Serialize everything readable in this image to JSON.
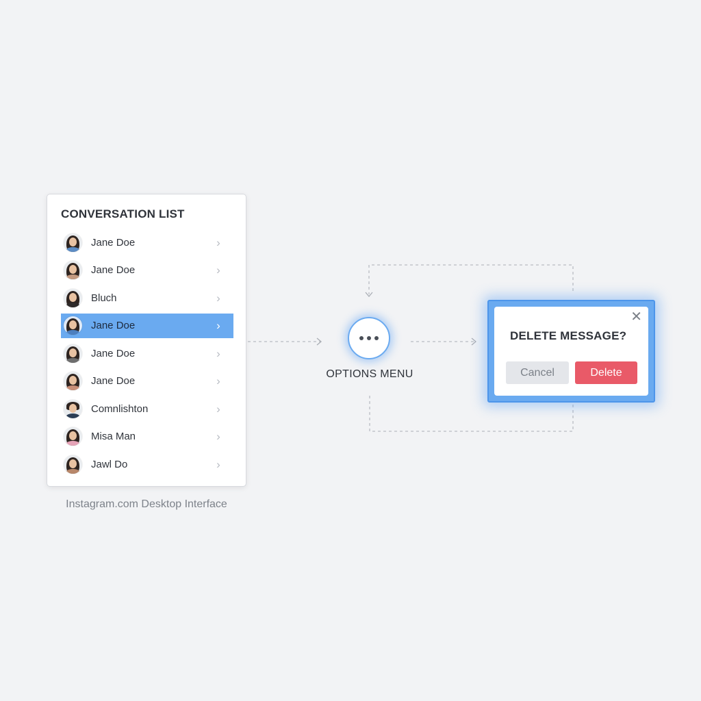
{
  "conversation_list": {
    "title": "CONVERSATION LIST",
    "items": [
      {
        "name": "Jane Doe",
        "selected": false,
        "avatar": "woman-avatar-icon",
        "shirt": "#5c8cc4"
      },
      {
        "name": "Jane Doe",
        "selected": false,
        "avatar": "woman-avatar-icon",
        "shirt": "#c49a80"
      },
      {
        "name": "Bluch",
        "selected": false,
        "avatar": "woman-avatar-icon",
        "shirt": "#2e2a2a"
      },
      {
        "name": "Jane Doe",
        "selected": true,
        "avatar": "woman-avatar-icon",
        "shirt": "#4c7fbf"
      },
      {
        "name": "Jane Doe",
        "selected": false,
        "avatar": "woman-avatar-icon",
        "shirt": "#6e6e6e"
      },
      {
        "name": "Jane Doe",
        "selected": false,
        "avatar": "woman-avatar-icon",
        "shirt": "#c98f78"
      },
      {
        "name": "Comnlishton",
        "selected": false,
        "avatar": "man-avatar-icon",
        "shirt": "#2c3e55"
      },
      {
        "name": "Misa Man",
        "selected": false,
        "avatar": "woman-avatar-icon",
        "shirt": "#e6a4b8"
      },
      {
        "name": "Jawl Do",
        "selected": false,
        "avatar": "woman-avatar-icon",
        "shirt": "#b8876a"
      }
    ],
    "chevron": "chevron-right-icon"
  },
  "caption": "Instagram.com Desktop Interface",
  "options_menu": {
    "label": "OPTIONS MENU",
    "icon": "more-dots-icon"
  },
  "dialog": {
    "title": "DELETE MESSAGE?",
    "cancel_label": "Cancel",
    "delete_label": "Delete",
    "close_icon": "close-icon"
  },
  "colors": {
    "accent": "#6aaaf0",
    "delete": "#e95a68",
    "background": "#f2f3f5"
  }
}
